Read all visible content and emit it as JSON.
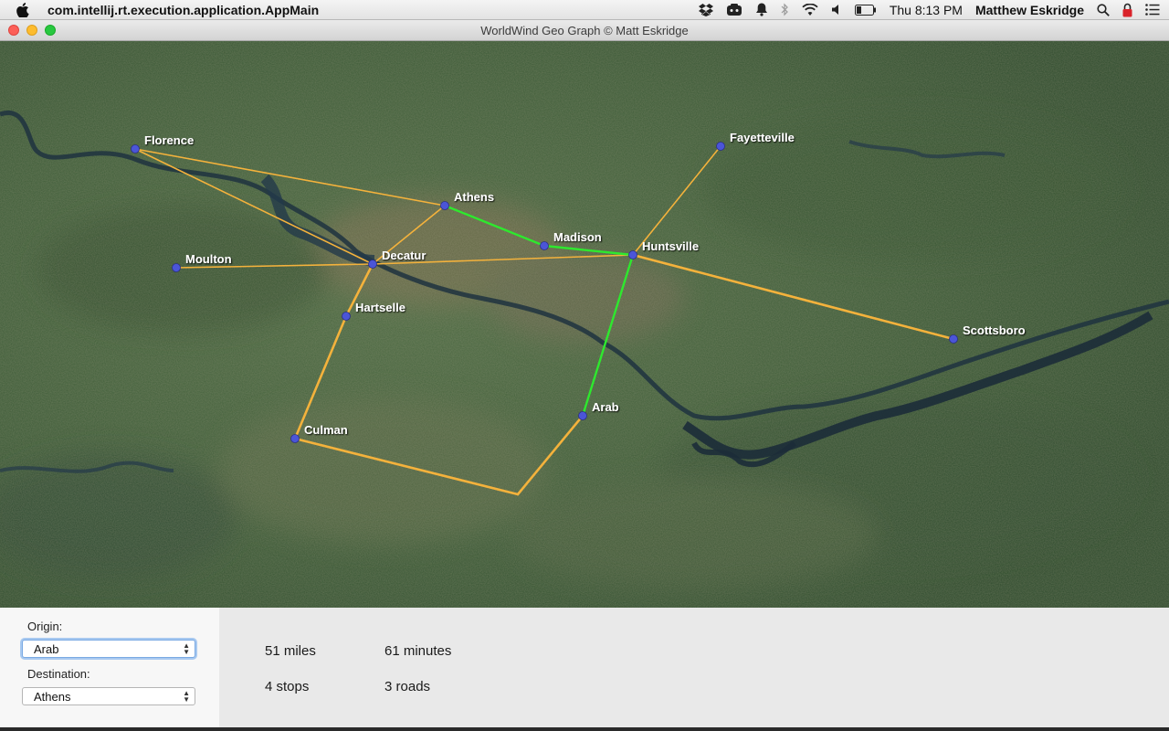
{
  "menubar": {
    "app_name": "com.intellij.rt.execution.application.AppMain",
    "clock": "Thu 8:13 PM",
    "user": "Matthew Eskridge",
    "icons": [
      "dropbox-icon",
      "teamviewer-icon",
      "notification-bell-icon",
      "bluetooth-icon",
      "wifi-icon",
      "volume-icon",
      "battery-icon",
      "spotlight-search-icon",
      "lock-icon",
      "notification-center-icon"
    ]
  },
  "window": {
    "title": "WorldWind Geo Graph © Matt Eskridge"
  },
  "map": {
    "cities": [
      {
        "id": "florence",
        "name": "Florence"
      },
      {
        "id": "athens",
        "name": "Athens"
      },
      {
        "id": "madison",
        "name": "Madison"
      },
      {
        "id": "huntsville",
        "name": "Huntsville"
      },
      {
        "id": "fayetteville",
        "name": "Fayetteville"
      },
      {
        "id": "moulton",
        "name": "Moulton"
      },
      {
        "id": "decatur",
        "name": "Decatur"
      },
      {
        "id": "hartselle",
        "name": "Hartselle"
      },
      {
        "id": "scottsboro",
        "name": "Scottsboro"
      },
      {
        "id": "arab",
        "name": "Arab"
      },
      {
        "id": "culman",
        "name": "Culman"
      }
    ],
    "roads": [
      {
        "from": "florence",
        "to": "athens",
        "route": false
      },
      {
        "from": "florence",
        "to": "decatur",
        "route": false
      },
      {
        "from": "moulton",
        "to": "decatur",
        "route": false
      },
      {
        "from": "decatur",
        "to": "athens",
        "route": false
      },
      {
        "from": "decatur",
        "to": "huntsville",
        "route": false
      },
      {
        "from": "decatur",
        "to": "hartselle",
        "route": false
      },
      {
        "from": "hartselle",
        "to": "culman",
        "route": false
      },
      {
        "from": "culman",
        "to": "junction",
        "route": false
      },
      {
        "from": "junction",
        "to": "arab",
        "route": false
      },
      {
        "from": "huntsville",
        "to": "fayetteville",
        "route": false
      },
      {
        "from": "huntsville",
        "to": "scottsboro",
        "route": false
      },
      {
        "from": "athens",
        "to": "madison",
        "route": true
      },
      {
        "from": "madison",
        "to": "huntsville",
        "route": true
      },
      {
        "from": "huntsville",
        "to": "arab",
        "route": true
      }
    ],
    "colors": {
      "road": "#f4b23c",
      "route": "#2ee82e",
      "node": "#4b55d8",
      "label": "#ffffff"
    }
  },
  "panel": {
    "origin_label": "Origin:",
    "origin_value": "Arab",
    "destination_label": "Destination:",
    "destination_value": "Athens",
    "distance": "51 miles",
    "time": "61 minutes",
    "stops": "4 stops",
    "roads": "3 roads"
  }
}
